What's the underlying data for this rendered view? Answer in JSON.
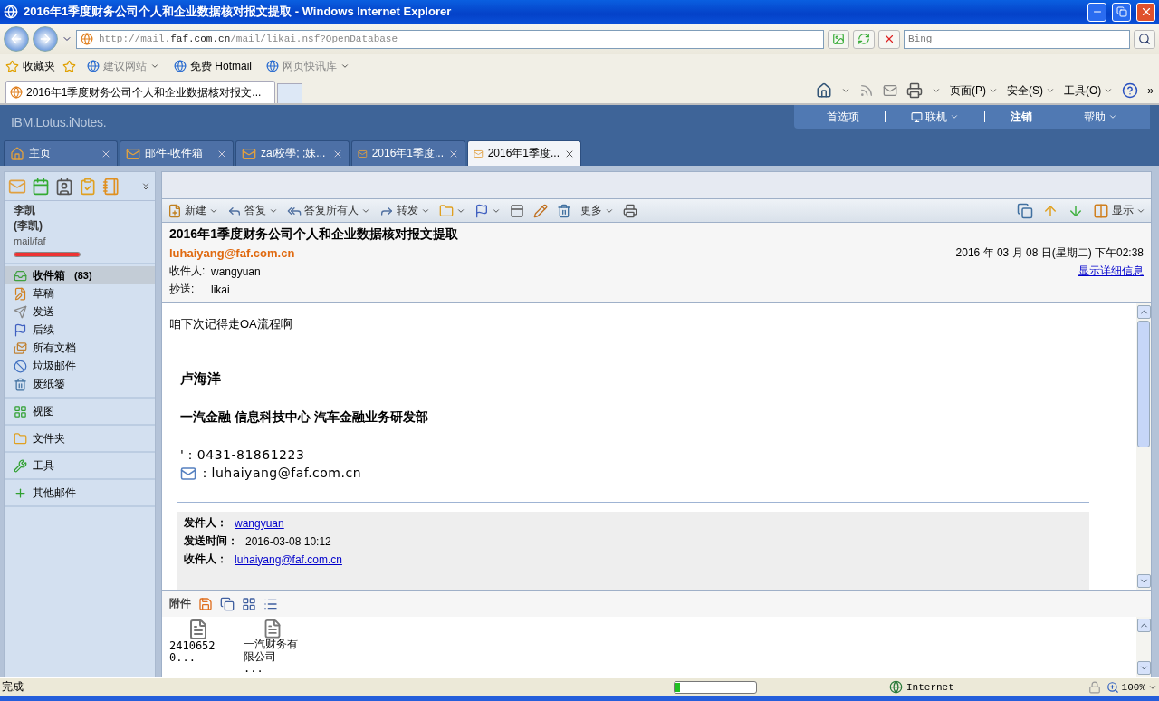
{
  "window": {
    "title": "2016年1季度财务公司个人和企业数据核对报文提取 - Windows Internet Explorer"
  },
  "address_bar": {
    "url_prefix": "http://mail.",
    "url_domain": "faf.com.cn",
    "url_path": "/mail/likai.nsf?OpenDatabase"
  },
  "search": {
    "placeholder": "Bing"
  },
  "favorites": {
    "label": "收藏夹",
    "links": [
      {
        "label": "建议网站",
        "dropdown": true,
        "disabled": true
      },
      {
        "label": "免费 Hotmail",
        "dropdown": false,
        "disabled": false
      },
      {
        "label": "网页快讯库",
        "dropdown": true,
        "disabled": true
      }
    ]
  },
  "browser_tabs": [
    {
      "label": "2016年1季度财务公司个人和企业数据核对报文...",
      "selected": true
    }
  ],
  "command_bar": {
    "items": [
      {
        "label": "页面(P)"
      },
      {
        "label": "安全(S)"
      },
      {
        "label": "工具(O)"
      }
    ],
    "overflow": "»"
  },
  "app": {
    "logo": "IBM.Lotus.iNotes.",
    "menu": [
      {
        "label": "首选项",
        "dropdown": false,
        "emphasized": false,
        "kind": "text"
      },
      {
        "label": "联机",
        "dropdown": true,
        "emphasized": false,
        "kind": "online"
      },
      {
        "label": "注销",
        "dropdown": false,
        "emphasized": true,
        "kind": "text"
      },
      {
        "label": "帮助",
        "dropdown": true,
        "emphasized": false,
        "kind": "text"
      }
    ]
  },
  "app_tabs": [
    {
      "label": "主页",
      "kind": "home",
      "selected": false
    },
    {
      "label": "邮件-收件箱",
      "kind": "mail",
      "selected": false
    },
    {
      "label": "zai校學; ;妹...",
      "kind": "mail",
      "selected": false
    },
    {
      "label": "2016年1季度...",
      "kind": "mail",
      "selected": false
    },
    {
      "label": "2016年1季度...",
      "kind": "mail",
      "selected": true
    }
  ],
  "sidebar": {
    "user_name": "李凯",
    "user_alias": "(李凯)",
    "database": "mail/faf",
    "quota": {
      "level": 1
    },
    "folders": [
      {
        "label": "收件箱",
        "count": "(83)",
        "kind": "inbox",
        "selected": true
      },
      {
        "label": "草稿",
        "kind": "drafts",
        "selected": false
      },
      {
        "label": "发送",
        "kind": "sent",
        "selected": false
      },
      {
        "label": "后续",
        "kind": "followup",
        "selected": false
      },
      {
        "label": "所有文档",
        "kind": "all",
        "selected": false
      },
      {
        "label": "垃圾邮件",
        "kind": "junk",
        "selected": false
      },
      {
        "label": "废纸篓",
        "kind": "trash",
        "selected": false
      }
    ],
    "sections": [
      {
        "label": "视图",
        "kind": "views"
      },
      {
        "label": "文件夹",
        "kind": "folders"
      },
      {
        "label": "工具",
        "kind": "tools"
      },
      {
        "label": "其他邮件",
        "kind": "other"
      }
    ]
  },
  "toolbar": {
    "actions": [
      {
        "label": "新建",
        "kind": "new",
        "dropdown": true
      },
      {
        "label": "答复",
        "kind": "reply",
        "dropdown": true
      },
      {
        "label": "答复所有人",
        "kind": "replyall",
        "dropdown": true
      },
      {
        "label": "转发",
        "kind": "forward",
        "dropdown": true
      },
      {
        "kind": "folder",
        "dropdown": true
      },
      {
        "kind": "flag",
        "dropdown": true
      },
      {
        "kind": "view",
        "dropdown": false
      },
      {
        "kind": "edit",
        "dropdown": false
      },
      {
        "kind": "trash",
        "dropdown": false
      },
      {
        "label": "更多",
        "kind": "more",
        "dropdown": true
      },
      {
        "kind": "print",
        "dropdown": false
      }
    ],
    "right": [
      {
        "kind": "copy"
      },
      {
        "kind": "up"
      },
      {
        "kind": "down"
      },
      {
        "label": "显示",
        "kind": "display"
      }
    ]
  },
  "message": {
    "subject": "2016年1季度财务公司个人和企业数据核对报文提取",
    "from": "luhaiyang@faf.com.cn",
    "date": "2016 年  03 月  08 日(星期二) 下午02:38",
    "to_label": "收件人:",
    "to": "wangyuan",
    "cc_label": "抄送:",
    "cc": "likai",
    "details_link": "显示详细信息",
    "greeting": "咱下次记得走OA流程啊",
    "signature_name": "卢海洋",
    "signature_org": "一汽金融  信息科技中心  汽车金融业务研发部",
    "phone": "'：0431-81861223",
    "email": "：luhaiyang@faf.com.cn",
    "quoted": [
      {
        "label": "发件人：",
        "value": "wangyuan",
        "link": true
      },
      {
        "label": "发送时间：",
        "value": "2016-03-08 10:12",
        "link": false
      },
      {
        "label": "收件人：",
        "value": "luhaiyang@faf.com.cn",
        "link": true
      }
    ]
  },
  "attachments": {
    "label": "附件",
    "files": [
      {
        "name": "24106520..."
      },
      {
        "name": "一汽财务有限公司 ..."
      }
    ]
  },
  "status_bar": {
    "text": "完成",
    "progress": {
      "level": 0.06
    },
    "zone": "Internet",
    "zoom": "100%"
  }
}
